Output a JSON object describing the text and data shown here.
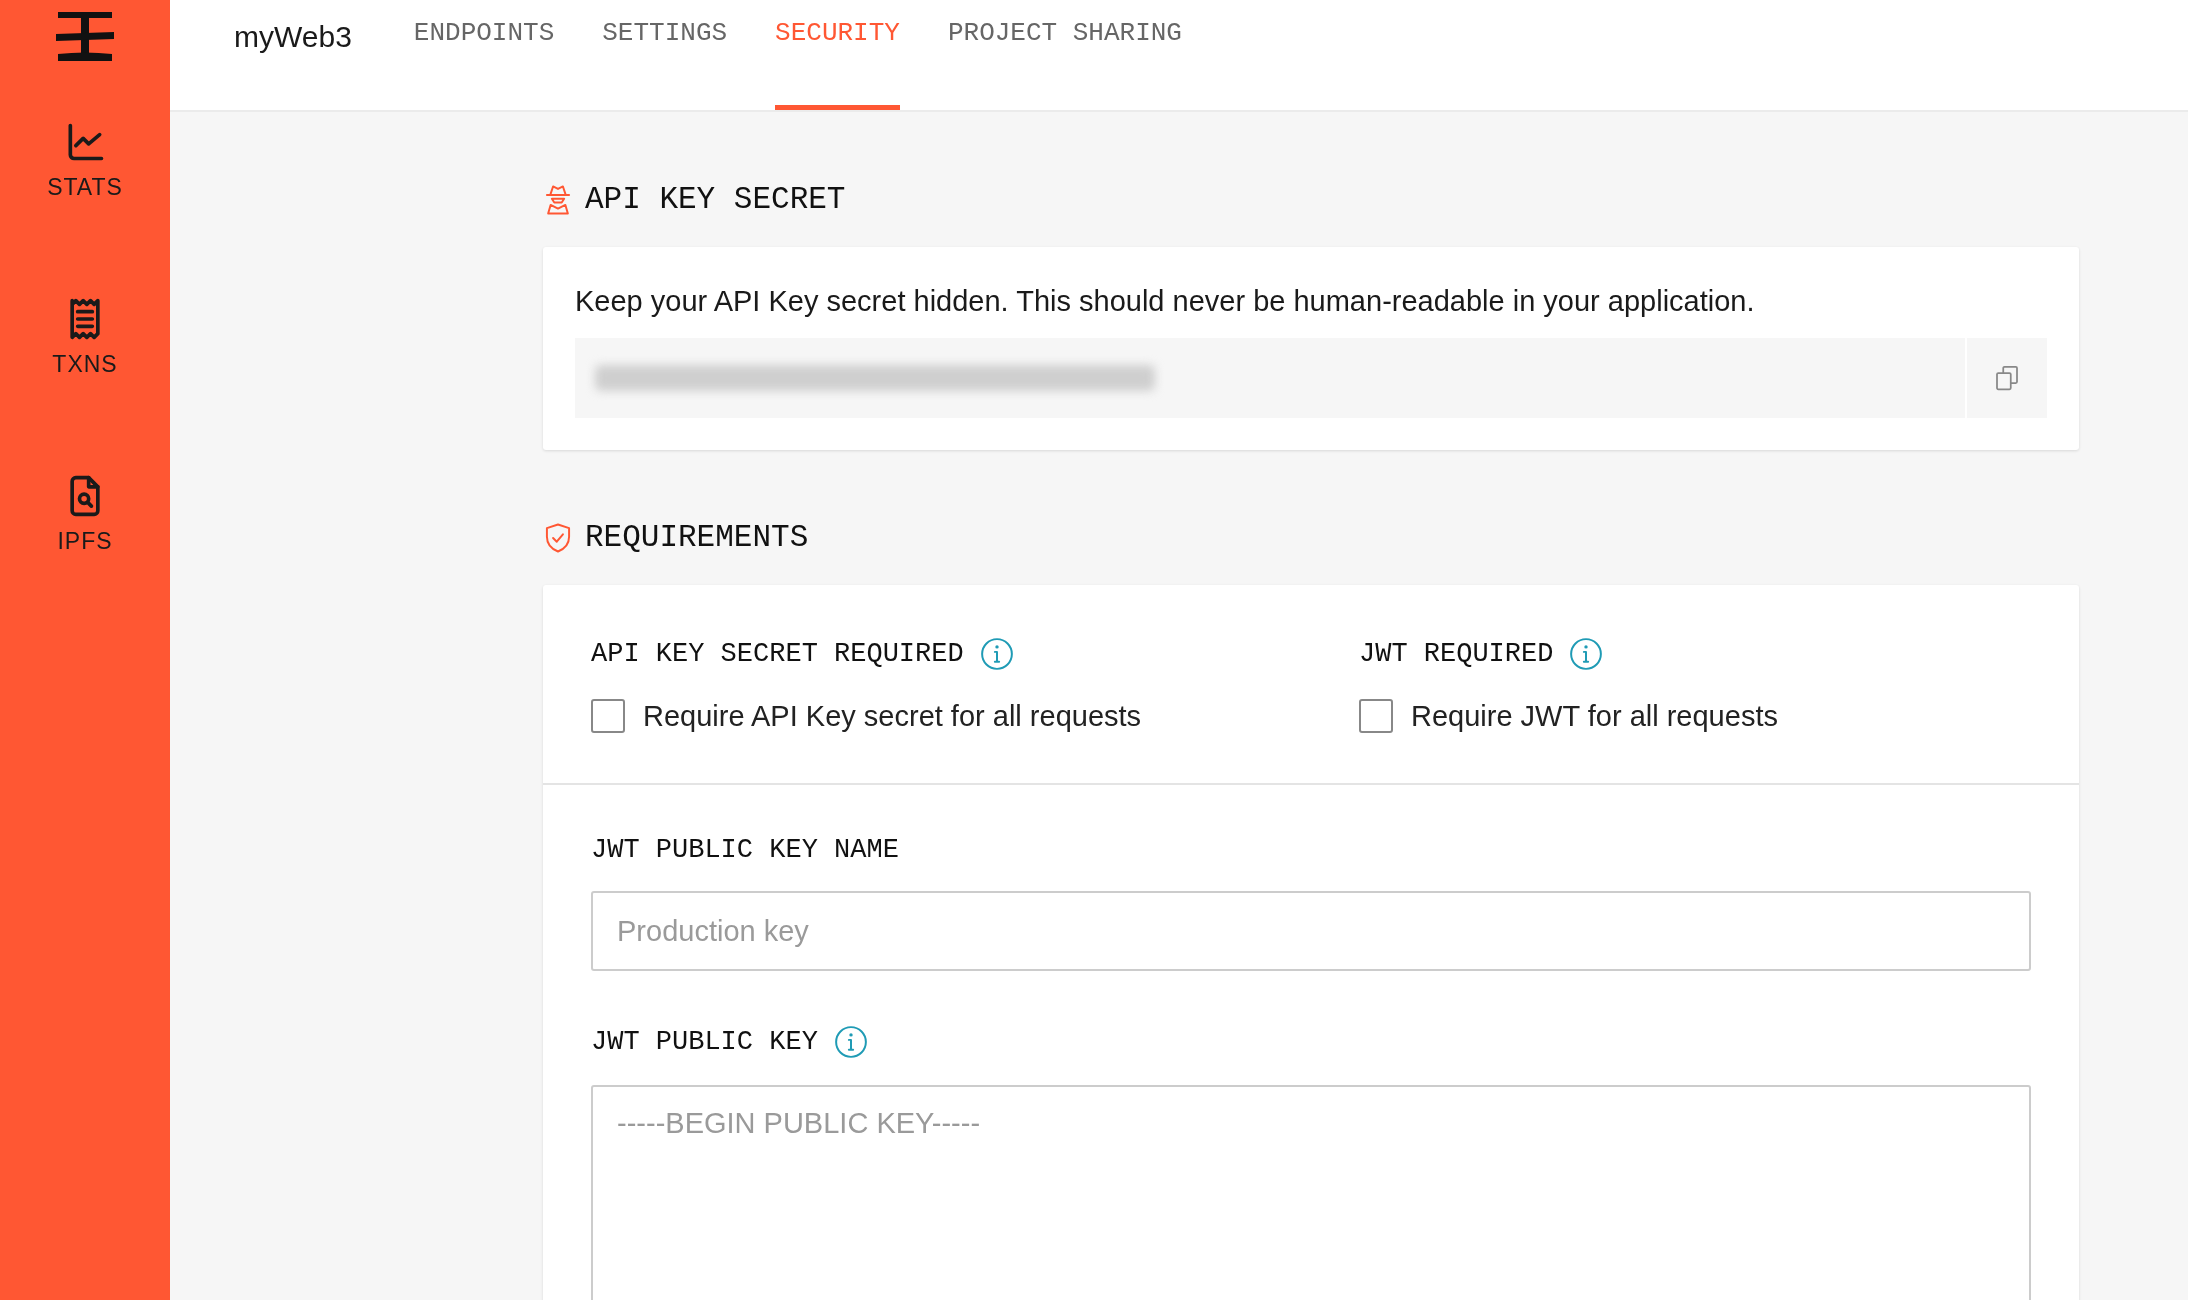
{
  "sidebar": {
    "items": [
      {
        "kind": "stats",
        "label": "STATS"
      },
      {
        "kind": "txns",
        "label": "TXNS"
      },
      {
        "kind": "ipfs",
        "label": "IPFS"
      }
    ]
  },
  "header": {
    "project": "myWeb3",
    "tabs": [
      {
        "label": "ENDPOINTS",
        "selected": false
      },
      {
        "label": "SETTINGS",
        "selected": false
      },
      {
        "label": "SECURITY",
        "selected": true
      },
      {
        "label": "PROJECT SHARING",
        "selected": false
      }
    ]
  },
  "api_key_section": {
    "title": "API KEY SECRET",
    "description": "Keep your API Key secret hidden. This should never be human-readable in your application."
  },
  "requirements_section": {
    "title": "REQUIREMENTS",
    "options": [
      {
        "label": "API KEY SECRET REQUIRED",
        "checkbox_label": "Require API Key secret for all requests",
        "checked": false
      },
      {
        "label": "JWT REQUIRED",
        "checkbox_label": "Require JWT for all requests",
        "checked": false
      }
    ],
    "jwt_name": {
      "label": "JWT PUBLIC KEY NAME",
      "placeholder": "Production key"
    },
    "jwt_key": {
      "label": "JWT PUBLIC KEY",
      "placeholder": "-----BEGIN PUBLIC KEY-----"
    }
  }
}
